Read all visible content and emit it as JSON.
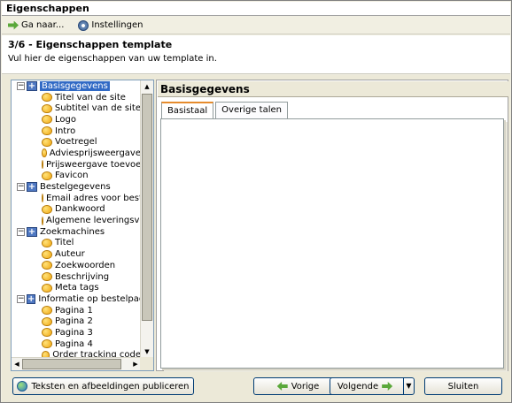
{
  "window": {
    "title": "Eigenschappen"
  },
  "toolbar": {
    "goto_label": "Ga naar...",
    "settings_label": "Instellingen"
  },
  "header": {
    "title": "3/6 - Eigenschappen template",
    "subtitle": "Vul hier de eigenschappen van uw template in."
  },
  "tree": {
    "groups": [
      {
        "label": "Basisgegevens",
        "children": [
          "Titel van de site",
          "Subtitel van de site",
          "Logo",
          "Intro",
          "Voetregel",
          "Adviesprijsweergave",
          "Prijsweergave toevoeging",
          "Favicon"
        ]
      },
      {
        "label": "Bestelgegevens",
        "children": [
          "Email adres voor bestellingen",
          "Dankwoord",
          "Algemene leveringsvoorwaarden"
        ]
      },
      {
        "label": "Zoekmachines",
        "children": [
          "Titel",
          "Auteur",
          "Zoekwoorden",
          "Beschrijving",
          "Meta tags"
        ]
      },
      {
        "label": "Informatie op bestelpagina's",
        "children": [
          "Pagina 1",
          "Pagina 2",
          "Pagina 3",
          "Pagina 4",
          "Order tracking code"
        ]
      }
    ]
  },
  "panel": {
    "title": "Basisgegevens",
    "tabs": [
      "Basistaal",
      "Overige talen"
    ]
  },
  "footer": {
    "publish_label": "Teksten en afbeeldingen publiceren",
    "prev_label": "Vorige",
    "next_label": "Volgende",
    "close_label": "Sluiten"
  },
  "icons": {
    "goto": "arrow-right-icon",
    "settings": "gear-icon",
    "group": "folder-plus-icon",
    "leaf": "property-icon",
    "publish": "globe-icon",
    "prev": "arrow-left-icon",
    "next": "arrow-right-icon"
  }
}
